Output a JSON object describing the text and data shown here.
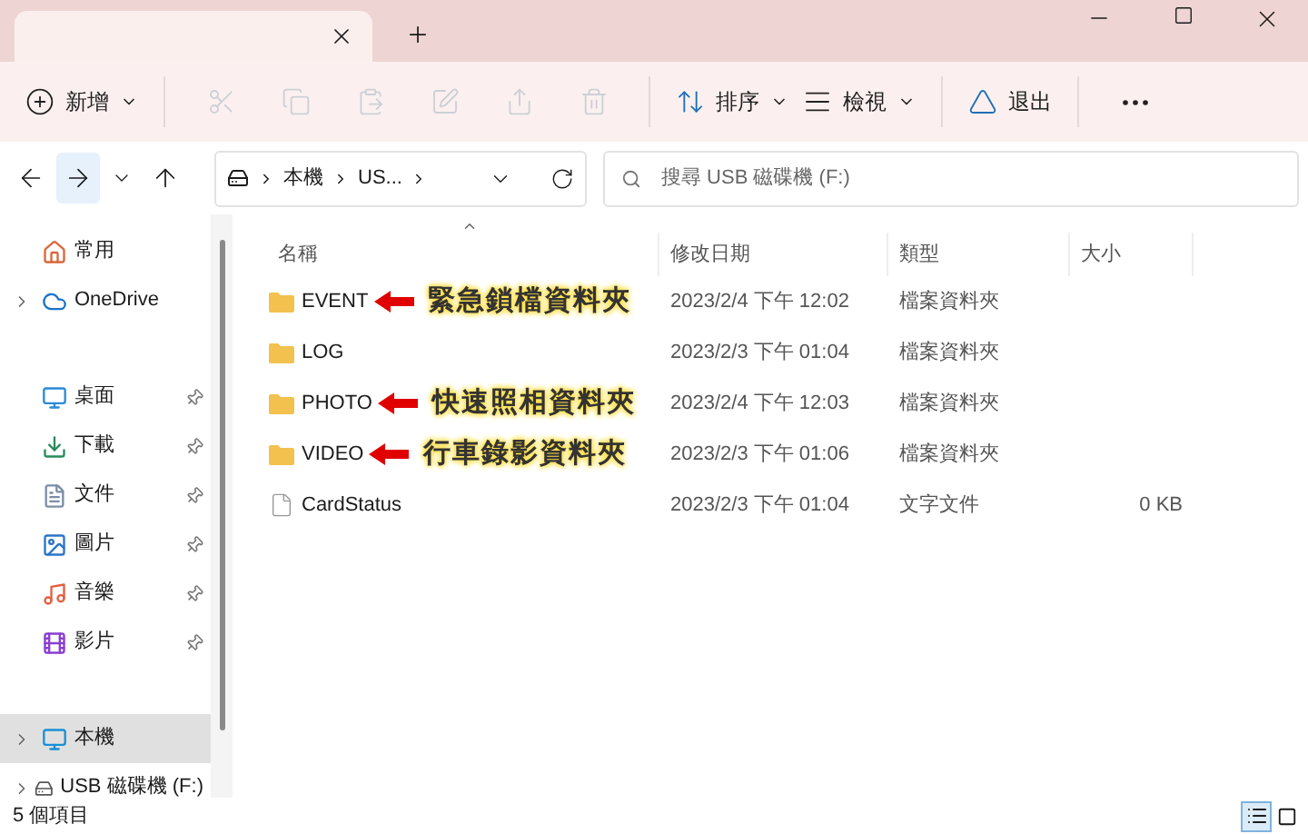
{
  "toolbar": [
    {
      "kind": "new",
      "label": "新增",
      "menu": true,
      "disabled": false
    },
    {
      "kind": "cut",
      "disabled": true
    },
    {
      "kind": "copy",
      "disabled": true
    },
    {
      "kind": "paste",
      "disabled": true
    },
    {
      "kind": "rename",
      "disabled": true
    },
    {
      "kind": "share",
      "disabled": true
    },
    {
      "kind": "delete",
      "disabled": true
    },
    {
      "kind": "sort",
      "label": "排序",
      "menu": true,
      "disabled": false
    },
    {
      "kind": "view",
      "label": "檢視",
      "menu": true,
      "disabled": false
    },
    {
      "kind": "eject",
      "label": "退出",
      "menu": false,
      "disabled": false
    },
    {
      "kind": "more",
      "disabled": false
    }
  ],
  "nav": [
    {
      "kind": "back",
      "hovered": false
    },
    {
      "kind": "forward",
      "hovered": true
    },
    {
      "kind": "recent",
      "hovered": false
    },
    {
      "kind": "up",
      "hovered": false
    }
  ],
  "address": {
    "segments": [
      "本機",
      "US..."
    ]
  },
  "search": {
    "placeholder": "搜尋 USB 磁碟機 (F:)"
  },
  "sidebar": {
    "sections": [
      [
        {
          "kind": "home",
          "label": "常用",
          "expandable": false,
          "pinned": false,
          "selected": false
        },
        {
          "kind": "cloud",
          "label": "OneDrive",
          "expandable": true,
          "pinned": false,
          "selected": false
        }
      ],
      [
        {
          "kind": "desktop",
          "label": "桌面",
          "expandable": false,
          "pinned": true,
          "selected": false
        },
        {
          "kind": "download",
          "label": "下載",
          "expandable": false,
          "pinned": true,
          "selected": false
        },
        {
          "kind": "document",
          "label": "文件",
          "expandable": false,
          "pinned": true,
          "selected": false
        },
        {
          "kind": "pictures",
          "label": "圖片",
          "expandable": false,
          "pinned": true,
          "selected": false
        },
        {
          "kind": "music",
          "label": "音樂",
          "expandable": false,
          "pinned": true,
          "selected": false
        },
        {
          "kind": "videos",
          "label": "影片",
          "expandable": false,
          "pinned": true,
          "selected": false
        }
      ],
      [
        {
          "kind": "pc",
          "label": "本機",
          "expandable": true,
          "pinned": false,
          "selected": true
        },
        {
          "kind": "drive",
          "label": "USB 磁碟機 (F:)",
          "expandable": true,
          "pinned": false,
          "selected": false
        }
      ]
    ]
  },
  "table": {
    "columns": [
      {
        "label": "名稱",
        "sorted": true
      },
      {
        "label": "修改日期",
        "sorted": false
      },
      {
        "label": "類型",
        "sorted": false
      },
      {
        "label": "大小",
        "sorted": false
      }
    ],
    "rows": [
      {
        "kind": "folder",
        "name": "EVENT",
        "modified": "2023/2/4 下午 12:02",
        "type": "檔案資料夾",
        "annotation": "緊急鎖檔資料夾"
      },
      {
        "kind": "folder",
        "name": "LOG",
        "modified": "2023/2/3 下午 01:04",
        "type": "檔案資料夾"
      },
      {
        "kind": "folder",
        "name": "PHOTO",
        "modified": "2023/2/4 下午 12:03",
        "type": "檔案資料夾",
        "annotation": "快速照相資料夾"
      },
      {
        "kind": "folder",
        "name": "VIDEO",
        "modified": "2023/2/3 下午 01:06",
        "type": "檔案資料夾",
        "annotation": "行車錄影資料夾"
      },
      {
        "kind": "file",
        "name": "CardStatus",
        "modified": "2023/2/3 下午 01:04",
        "type": "文字文件",
        "size": "0 KB"
      }
    ]
  },
  "status_bar": {
    "text": "5 個項目",
    "views": [
      {
        "kind": "details",
        "selected": true
      },
      {
        "kind": "tiles",
        "selected": false
      }
    ]
  }
}
